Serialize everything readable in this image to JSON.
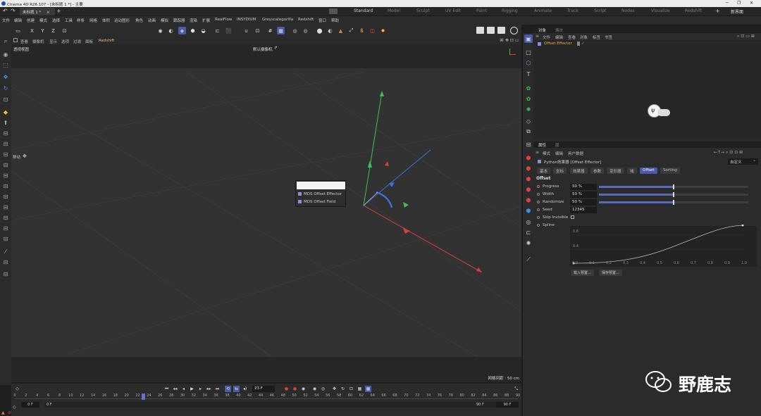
{
  "window": {
    "title": "Cinema 4D R26.107 - [未标题 1 *] - 主要",
    "doc_tab": "未标题 1 *"
  },
  "layouts": {
    "items": [
      "Standard",
      "Model",
      "Sculpt",
      "UV Edit",
      "Paint",
      "Rigging",
      "Animate",
      "Track",
      "Script",
      "Nodes",
      "Visualize",
      "Redshift"
    ],
    "new_layout": "新界面"
  },
  "menubar": [
    "文件",
    "编辑",
    "创建",
    "模式",
    "选择",
    "工具",
    "样条",
    "网格",
    "体积",
    "运动图形",
    "角色",
    "动画",
    "模拟",
    "跟踪器",
    "渲染",
    "扩展",
    "RealFlow",
    "INSYDIUM",
    "Greyscalegorilla",
    "Redshift",
    "窗口",
    "帮助"
  ],
  "toolbar": {
    "axis_x": "X",
    "axis_y": "Y",
    "axis_z": "Z"
  },
  "viewport": {
    "menu": [
      "查看",
      "摄像机",
      "显示",
      "选项",
      "过滤",
      "面板",
      "Redshift"
    ],
    "view_name": "透视视图",
    "camera": "默认摄像机",
    "grid_label": "网格间距 : 50 cm",
    "tool_label": "移动"
  },
  "popup": {
    "items": [
      "MDS Offset Effector",
      "MDS Offset Field"
    ]
  },
  "timeline": {
    "ticks": [
      0,
      2,
      4,
      6,
      8,
      10,
      12,
      14,
      16,
      18,
      20,
      22,
      24,
      26,
      28,
      30,
      32,
      34,
      36,
      38,
      40,
      42,
      44,
      46,
      48,
      50,
      52,
      54,
      56,
      58,
      60,
      62,
      64,
      66,
      68,
      70,
      72,
      74,
      76,
      78,
      80,
      82,
      84,
      86,
      88,
      90
    ],
    "current_frame": "23 F",
    "start_a": "0 F",
    "start_b": "0 F",
    "end_a": "90 F",
    "end_b": "90 F",
    "playhead_frame": 23
  },
  "object_manager": {
    "tabs": [
      "对象",
      "场次"
    ],
    "menu": [
      "文件",
      "编辑",
      "查看",
      "对象",
      "标签",
      "书签"
    ],
    "object_name": "Offset Effector"
  },
  "attributes": {
    "tabs": [
      "属性",
      "层"
    ],
    "menu": [
      "模式",
      "编辑",
      "用户数据"
    ],
    "header": "Python效果器 [Offset Effector]",
    "preset": "自定义",
    "section_tabs": [
      "基本",
      "坐标",
      "效果器",
      "参数",
      "变形器",
      "域",
      "Offset",
      "Sorting"
    ],
    "active_tab": "Offset",
    "section_title": "Offset",
    "params": [
      {
        "label": "Progress",
        "value": "50 %",
        "fraction": 0.5
      },
      {
        "label": "Width",
        "value": "50 %",
        "fraction": 0.5
      },
      {
        "label": "Randomize",
        "value": "50 %",
        "fraction": 0.5
      },
      {
        "label": "Seed",
        "value": "12345"
      },
      {
        "label": "Skip Invisible"
      },
      {
        "label": "Spline"
      }
    ],
    "spline_y_labels": [
      "0.8",
      "0.4"
    ],
    "spline_x_labels": [
      "0.0",
      "0.1",
      "0.2",
      "0.3",
      "0.4",
      "0.5",
      "0.6",
      "0.7",
      "0.8",
      "0.9",
      "1.0"
    ],
    "load_preset": "载入预置...",
    "save_preset": "保存预置..."
  },
  "watermark": {
    "text": "野鹿志"
  },
  "colors": {
    "accent": "#4a5aa8",
    "axis_x": "#d94040",
    "axis_y": "#3fbf5a",
    "axis_z": "#3f6fd9"
  }
}
